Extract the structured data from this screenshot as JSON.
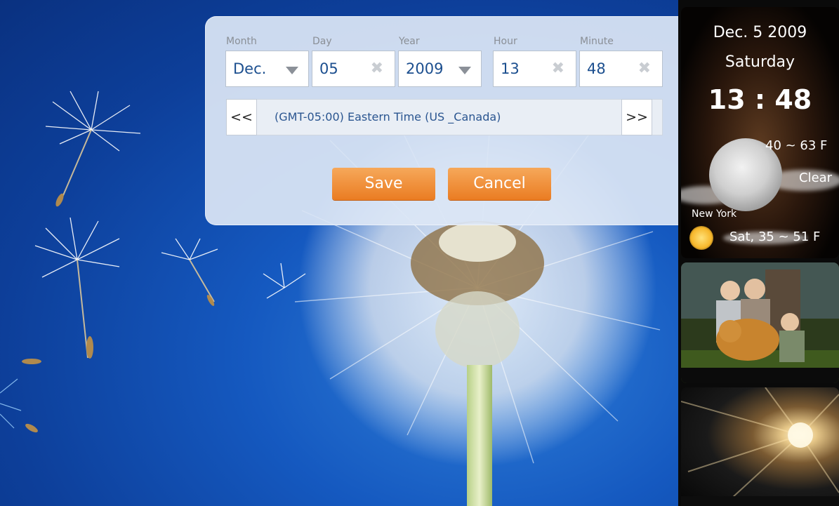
{
  "dialog": {
    "labels": {
      "month": "Month",
      "day": "Day",
      "year": "Year",
      "hour": "Hour",
      "minute": "Minute"
    },
    "values": {
      "month": "Dec.",
      "day": "05",
      "year": "2009",
      "hour": "13",
      "minute": "48"
    },
    "timezone": "(GMT-05:00) Eastern Time (US _Canada)",
    "prev_label": "<<",
    "next_label": ">>",
    "save_label": "Save",
    "cancel_label": "Cancel",
    "clear_glyph": "✖"
  },
  "clock": {
    "date": "Dec. 5 2009",
    "weekday": "Saturday",
    "time": "13 : 48",
    "temp_range": "40 ~ 63 F",
    "condition": "Clear",
    "city": "New York",
    "forecast": "Sat, 35 ~ 51 F"
  },
  "icons": {
    "dropdown": "chevron-down-icon",
    "clear": "close-icon",
    "weather_now": "moon-icon",
    "weather_forecast": "sun-icon"
  },
  "colors": {
    "accent_button": "#ea7c22",
    "value_text": "#1c4f8f",
    "wallpaper_sky": "#1559c0"
  }
}
